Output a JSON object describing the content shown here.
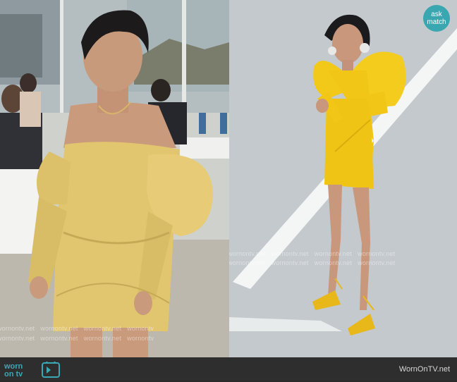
{
  "badge": {
    "text": "ask match"
  },
  "watermark": {
    "text": "wornontv.net",
    "text_cut": "wornontv"
  },
  "footer": {
    "logo_word1": "worn",
    "logo_word2": "on tv",
    "credit": "WornOnTV.net"
  },
  "colors": {
    "badge": "#3aa6b0",
    "dress_left": "#e2c66f",
    "dress_right": "#f2c919",
    "logo": "#39a9b5"
  }
}
